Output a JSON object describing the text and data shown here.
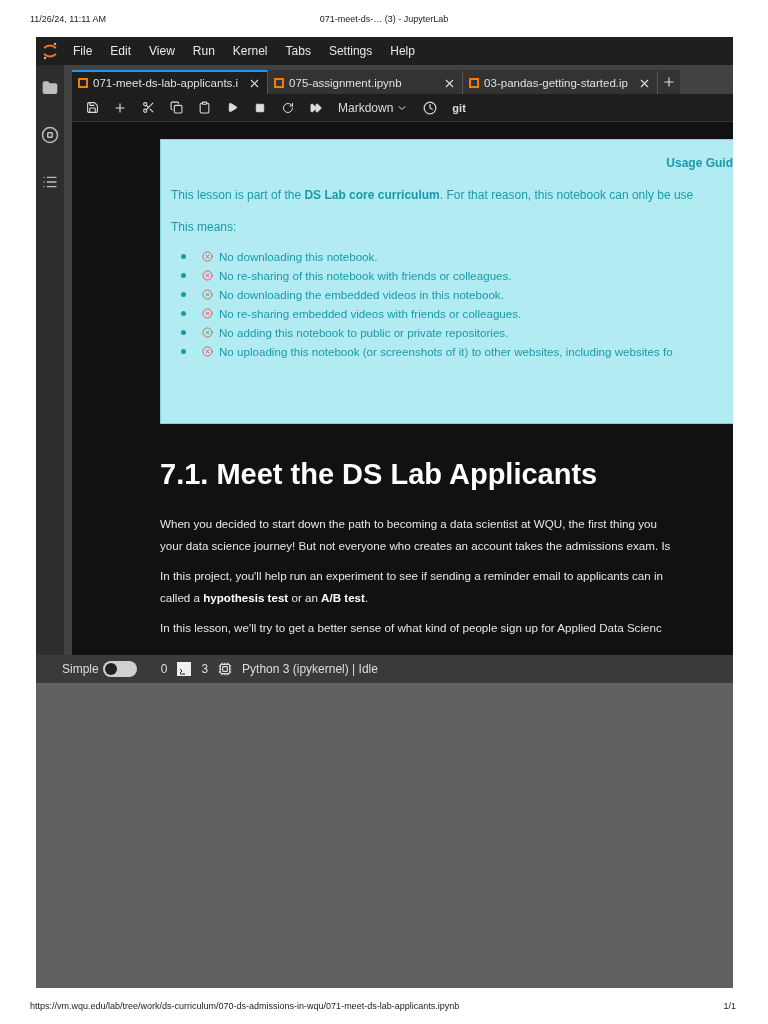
{
  "print_header": {
    "date": "11/26/24, 11:11 AM",
    "title": "071-meet-ds-… (3) - JupyterLab"
  },
  "menu": [
    "File",
    "Edit",
    "View",
    "Run",
    "Kernel",
    "Tabs",
    "Settings",
    "Help"
  ],
  "tabs": [
    {
      "label": "071-meet-ds-lab-applicants.i",
      "selected": true
    },
    {
      "label": "075-assignment.ipynb",
      "selected": false
    },
    {
      "label": "03-pandas-getting-started.ip",
      "selected": false
    }
  ],
  "toolbar": {
    "cell_type": "Markdown",
    "git": "git"
  },
  "notice": {
    "heading": "Usage Guid",
    "intro": "This lesson is part of the **DS Lab core curriculum**. For that reason, this notebook can only be use",
    "means": "This means:",
    "rules": [
      "No downloading this notebook.",
      "No re-sharing of this notebook with friends or colleagues.",
      "No downloading the embedded videos in this notebook.",
      "No re-sharing embedded videos with friends or colleagues.",
      "No adding this notebook to public or private repositories.",
      "No uploading this notebook (or screenshots of it) to other websites, including websites fo"
    ]
  },
  "heading": "7.1. Meet the DS Lab Applicants",
  "paragraphs": [
    "When you decided to start down the path to becoming a data scientist at WQU, the first thing you",
    "your data science journey! But not everyone who creates an account takes the admissions exam. Is",
    "In this project, you'll help run an experiment to see if sending a reminder email to applicants can in",
    "called a **hypothesis test** or an **A/B test**.",
    "In this lesson, we'll try to get a better sense of what kind of people sign up for Applied Data Scienc"
  ],
  "status_bar": {
    "mode_label": "Simple",
    "simple_on": false,
    "count_1": "0",
    "count_2": "3",
    "kernel": "Python 3 (ipykernel) | Idle"
  },
  "print_footer": {
    "url": "https://vm.wqu.edu/lab/tree/work/ds-curriculum/070-ds-admissions-in-wqu/071-meet-ds-lab-applicants.ipynb",
    "page": "1/1"
  }
}
